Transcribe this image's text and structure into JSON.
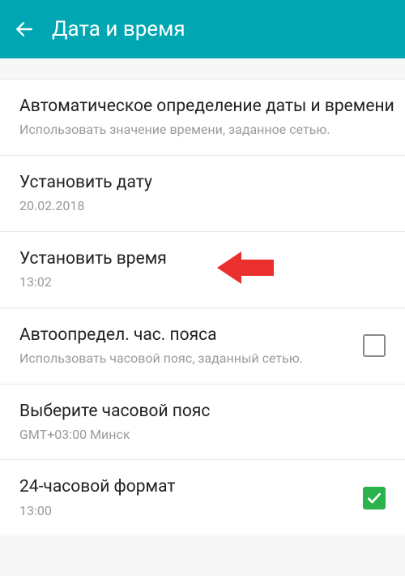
{
  "header": {
    "title": "Дата и время"
  },
  "items": {
    "auto_time": {
      "title": "Автоматическое определение даты и времени",
      "sub": "Использовать значение времени, заданное сетью.",
      "checked": false
    },
    "set_date": {
      "title": "Установить дату",
      "sub": "20.02.2018"
    },
    "set_time": {
      "title": "Установить время",
      "sub": "13:02"
    },
    "auto_zone": {
      "title": "Автоопредел. час. пояса",
      "sub": "Использовать часовой пояс, заданный сетью.",
      "checked": false
    },
    "select_zone": {
      "title": "Выберите часовой пояс",
      "sub": "GMT+03:00 Минск"
    },
    "format24": {
      "title": "24-часовой формат",
      "sub": "13:00",
      "checked": true
    }
  }
}
